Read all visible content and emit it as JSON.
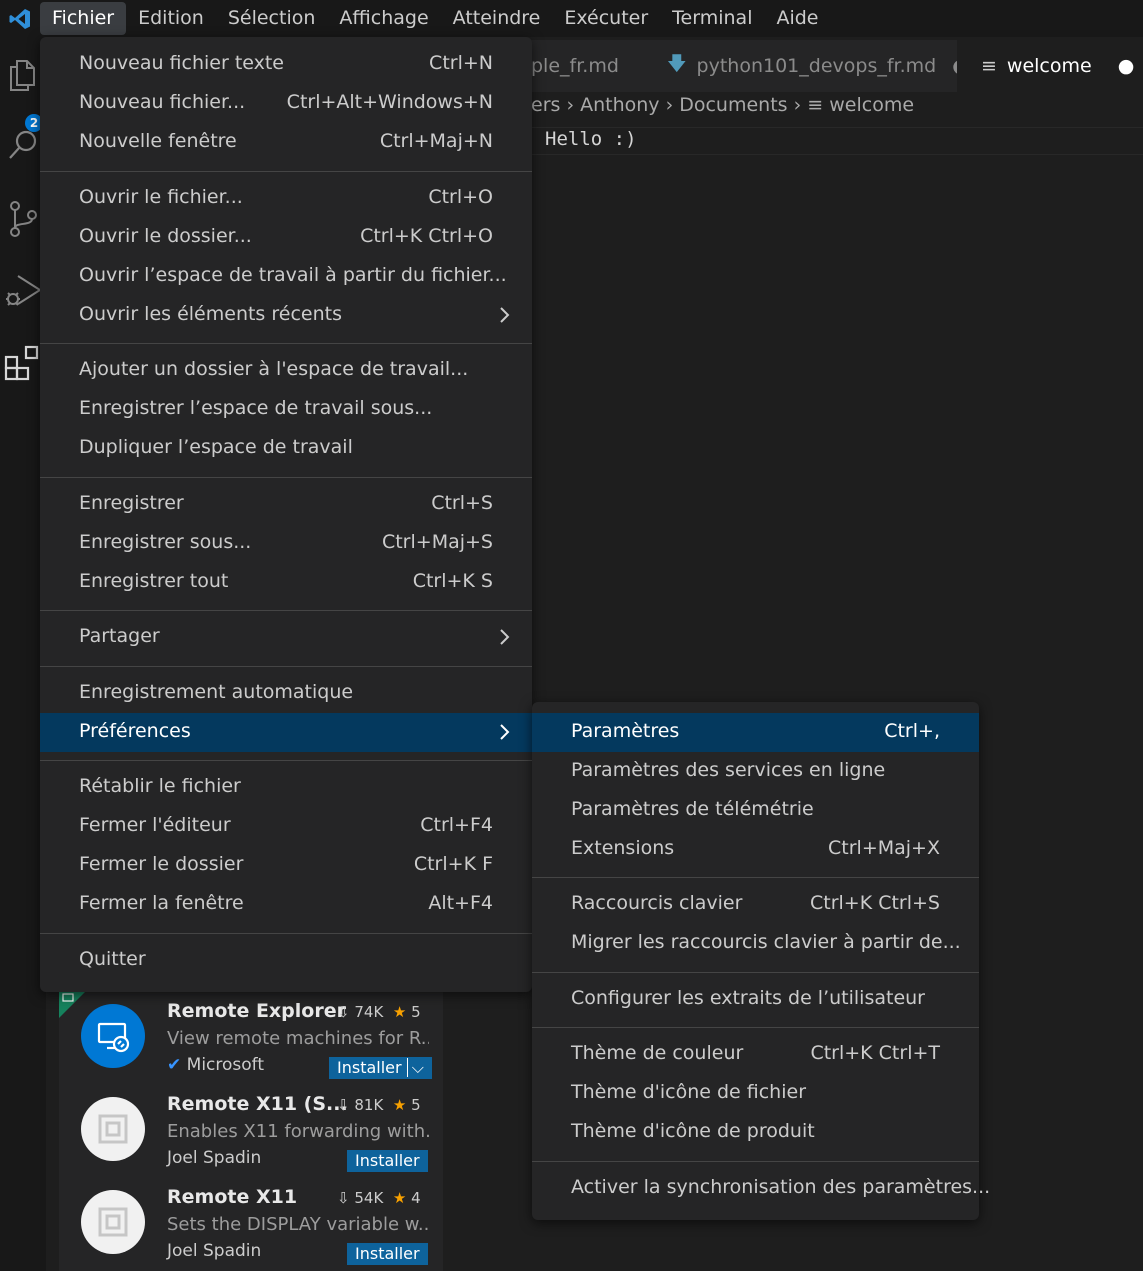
{
  "menubar": {
    "items": [
      "Fichier",
      "Edition",
      "Sélection",
      "Affichage",
      "Atteindre",
      "Exécuter",
      "Terminal",
      "Aide"
    ]
  },
  "activity": {
    "badge": "2"
  },
  "tabs": [
    {
      "label": "ple_fr.md"
    },
    {
      "label": "python101_devops_fr.md"
    },
    {
      "label": "welcome"
    }
  ],
  "breadcrumb": {
    "p1": "ers",
    "p2": "Anthony",
    "p3": "Documents",
    "p4": "welcome"
  },
  "editor": {
    "line1": "Hello :)"
  },
  "file_menu": {
    "items": [
      {
        "label": "Nouveau fichier texte",
        "shortcut": "Ctrl+N"
      },
      {
        "label": "Nouveau fichier...",
        "shortcut": "Ctrl+Alt+Windows+N"
      },
      {
        "label": "Nouvelle fenêtre",
        "shortcut": "Ctrl+Maj+N"
      },
      {
        "label": "Ouvrir le fichier...",
        "shortcut": "Ctrl+O"
      },
      {
        "label": "Ouvrir le dossier...",
        "shortcut": "Ctrl+K Ctrl+O"
      },
      {
        "label": "Ouvrir l’espace de travail à partir du fichier...",
        "shortcut": ""
      },
      {
        "label": "Ouvrir les éléments récents",
        "shortcut": ""
      },
      {
        "label": "Ajouter un dossier à l'espace de travail...",
        "shortcut": ""
      },
      {
        "label": "Enregistrer l’espace de travail sous...",
        "shortcut": ""
      },
      {
        "label": "Dupliquer l’espace de travail",
        "shortcut": ""
      },
      {
        "label": "Enregistrer",
        "shortcut": "Ctrl+S"
      },
      {
        "label": "Enregistrer sous...",
        "shortcut": "Ctrl+Maj+S"
      },
      {
        "label": "Enregistrer tout",
        "shortcut": "Ctrl+K S"
      },
      {
        "label": "Partager",
        "shortcut": ""
      },
      {
        "label": "Enregistrement automatique",
        "shortcut": ""
      },
      {
        "label": "Préférences",
        "shortcut": ""
      },
      {
        "label": "Rétablir le fichier",
        "shortcut": ""
      },
      {
        "label": "Fermer l'éditeur",
        "shortcut": "Ctrl+F4"
      },
      {
        "label": "Fermer le dossier",
        "shortcut": "Ctrl+K F"
      },
      {
        "label": "Fermer la fenêtre",
        "shortcut": "Alt+F4"
      },
      {
        "label": "Quitter",
        "shortcut": ""
      }
    ]
  },
  "pref_menu": {
    "items": [
      {
        "label": "Paramètres",
        "shortcut": "Ctrl+,"
      },
      {
        "label": "Paramètres des services en ligne",
        "shortcut": ""
      },
      {
        "label": "Paramètres de télémétrie",
        "shortcut": ""
      },
      {
        "label": "Extensions",
        "shortcut": "Ctrl+Maj+X"
      },
      {
        "label": "Raccourcis clavier",
        "shortcut": "Ctrl+K Ctrl+S"
      },
      {
        "label": "Migrer les raccourcis clavier à partir de...",
        "shortcut": ""
      },
      {
        "label": "Configurer les extraits de l’utilisateur",
        "shortcut": ""
      },
      {
        "label": "Thème de couleur",
        "shortcut": "Ctrl+K Ctrl+T"
      },
      {
        "label": "Thème d'icône de fichier",
        "shortcut": ""
      },
      {
        "label": "Thème d'icône de produit",
        "shortcut": ""
      },
      {
        "label": "Activer la synchronisation des paramètres...",
        "shortcut": ""
      }
    ]
  },
  "extensions": [
    {
      "name": "Remote Explorer",
      "downloads": "74K",
      "rating": "5",
      "desc": "View remote machines for R...",
      "publisher": "Microsoft",
      "install": "Installer"
    },
    {
      "name": "Remote X11 (S...",
      "downloads": "81K",
      "rating": "5",
      "desc": "Enables X11 forwarding with...",
      "publisher": "Joel Spadin",
      "install": "Installer"
    },
    {
      "name": "Remote X11",
      "downloads": "54K",
      "rating": "4",
      "desc": "Sets the DISPLAY variable w...",
      "publisher": "Joel Spadin",
      "install": "Installer"
    }
  ],
  "colors": {
    "accent": "#0078d4",
    "highlight": "#04395e",
    "install": "#0e639c",
    "star": "#f8a100"
  }
}
